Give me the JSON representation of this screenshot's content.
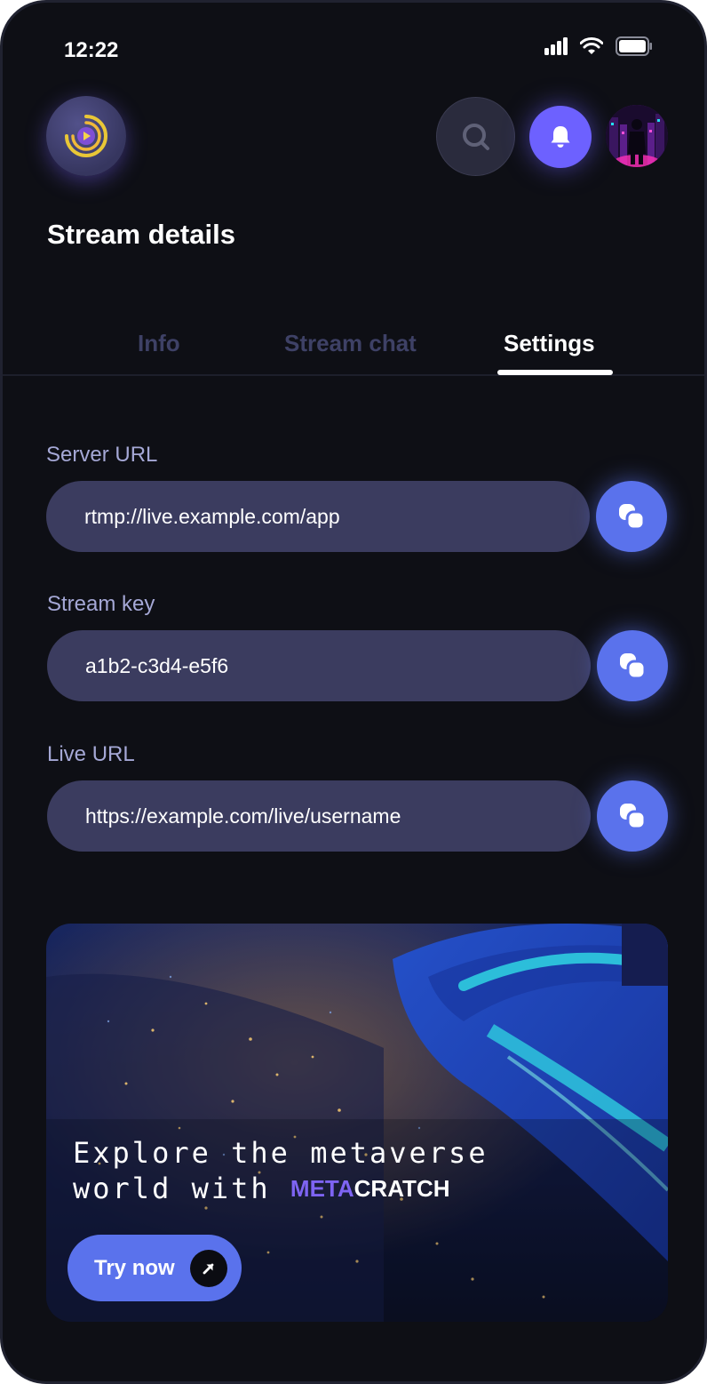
{
  "status_bar": {
    "time": "12:22"
  },
  "header": {
    "title": "Stream details",
    "search_icon": "search-icon",
    "bell_icon": "bell-icon",
    "logo_icon": "play-logo-icon"
  },
  "tabs": [
    {
      "label": "Info",
      "active": false
    },
    {
      "label": "Stream chat",
      "active": false
    },
    {
      "label": "Settings",
      "active": true
    }
  ],
  "fields": [
    {
      "label": "Server URL",
      "value": "rtmp://live.example.com/app",
      "action_icon": "copy-icon"
    },
    {
      "label": "Stream key",
      "value": "a1b2-c3d4-e5f6",
      "action_icon": "copy-icon"
    },
    {
      "label": "Live URL",
      "value": "https://example.com/live/username",
      "action_icon": "copy-icon"
    }
  ],
  "promo": {
    "line1": "Explore the metaverse",
    "line2": "world with",
    "brand_meta": "META",
    "brand_rest": "CRATCH",
    "button_label": "Try now",
    "button_icon": "arrow-up-right-icon"
  },
  "colors": {
    "background": "#0e0f15",
    "accent": "#5a72ec",
    "bell": "#6d61ff",
    "field": "#3b3c5f",
    "label": "#a5a8d6",
    "tab_inactive": "#3e4166"
  }
}
